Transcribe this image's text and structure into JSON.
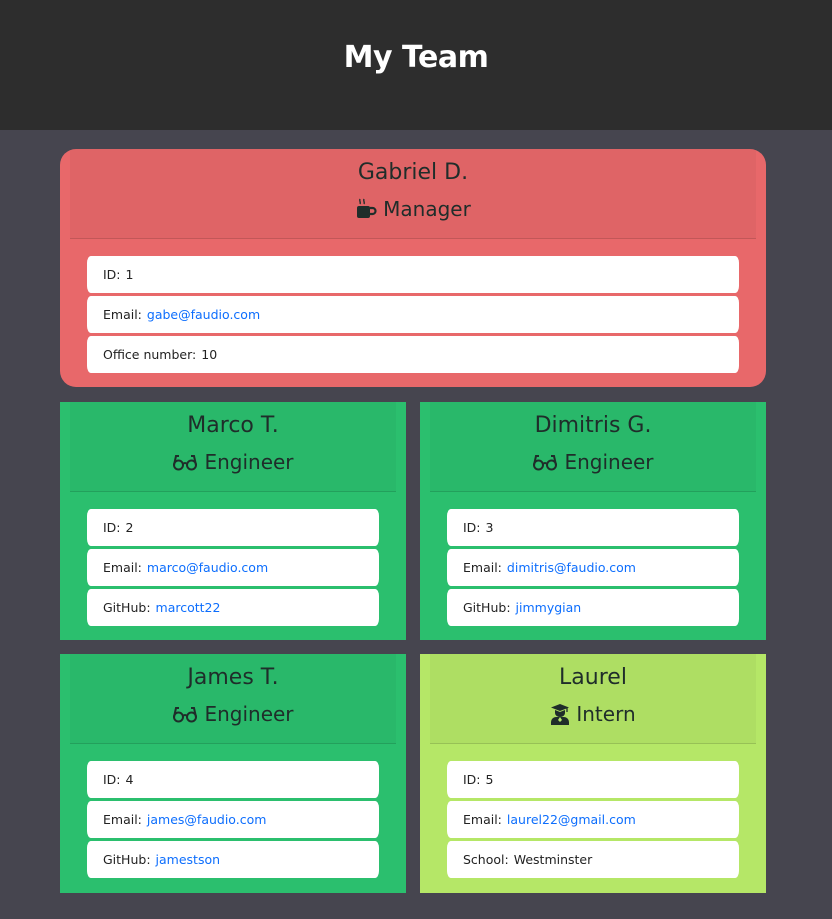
{
  "header": {
    "title": "My Team"
  },
  "manager": {
    "name": "Gabriel D.",
    "role": "Manager",
    "role_icon": "coffee-mug-icon",
    "id_label": "ID:",
    "id": "1",
    "email_label": "Email:",
    "email": "gabe@faudio.com",
    "office_label": "Office number:",
    "office": "10"
  },
  "engineers": [
    {
      "name": "Marco T.",
      "role": "Engineer",
      "role_icon": "glasses-icon",
      "id_label": "ID:",
      "id": "2",
      "email_label": "Email:",
      "email": "marco@faudio.com",
      "github_label": "GitHub:",
      "github": "marcott22"
    },
    {
      "name": "Dimitris G.",
      "role": "Engineer",
      "role_icon": "glasses-icon",
      "id_label": "ID:",
      "id": "3",
      "email_label": "Email:",
      "email": "dimitris@faudio.com",
      "github_label": "GitHub:",
      "github": "jimmygian"
    },
    {
      "name": "James T.",
      "role": "Engineer",
      "role_icon": "glasses-icon",
      "id_label": "ID:",
      "id": "4",
      "email_label": "Email:",
      "email": "james@faudio.com",
      "github_label": "GitHub:",
      "github": "jamestson"
    }
  ],
  "intern": {
    "name": "Laurel",
    "role": "Intern",
    "role_icon": "graduate-icon",
    "id_label": "ID:",
    "id": "5",
    "email_label": "Email:",
    "email": "laurel22@gmail.com",
    "school_label": "School:",
    "school": "Westminster"
  },
  "colors": {
    "header_bg": "#2d2d2d",
    "page_bg": "#46454f",
    "manager_bg": "#e8686a",
    "engineer_bg": "#2bbf6e",
    "intern_bg": "#b5e767",
    "link": "#0d6efd"
  }
}
